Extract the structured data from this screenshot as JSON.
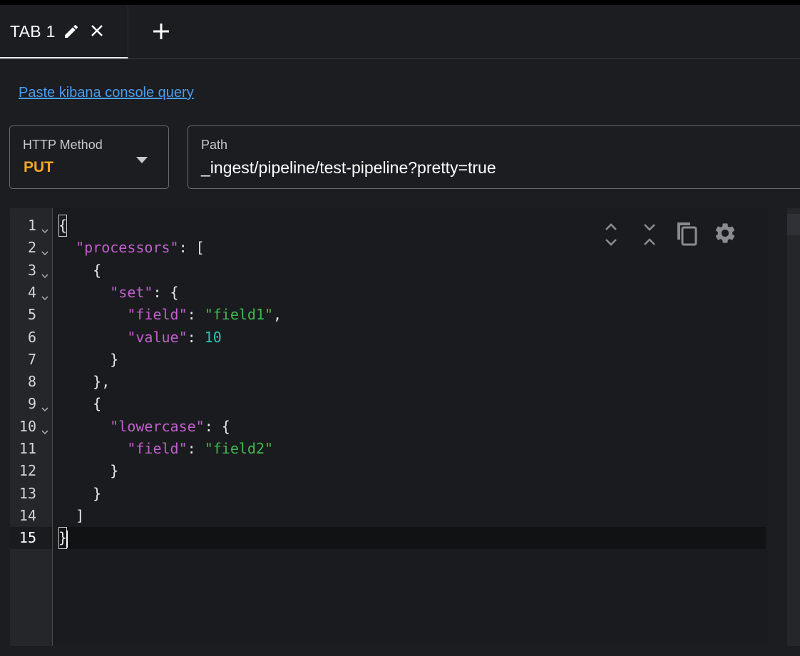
{
  "tabs": [
    {
      "label": "TAB 1",
      "active": true
    }
  ],
  "tab_actions": {
    "edit_icon": "pencil-icon",
    "close_icon": "close-icon",
    "add_icon": "plus-icon"
  },
  "paste_link": "Paste kibana console query",
  "method": {
    "label": "HTTP Method",
    "value": "PUT",
    "color": "#f5a623"
  },
  "path": {
    "label": "Path",
    "value": "_ingest/pipeline/test-pipeline?pretty=true"
  },
  "editor": {
    "line_numbers": [
      "1",
      "2",
      "3",
      "4",
      "5",
      "6",
      "7",
      "8",
      "9",
      "10",
      "11",
      "12",
      "13",
      "14",
      "15"
    ],
    "foldable_lines": [
      1,
      2,
      3,
      4,
      9,
      10
    ],
    "active_line": 15,
    "toolbar": [
      "expand-all-icon",
      "collapse-all-icon",
      "copy-icon",
      "gear-icon"
    ],
    "lines": [
      {
        "indent": "",
        "tokens": [
          {
            "t": "{",
            "c": "p"
          }
        ]
      },
      {
        "indent": "  ",
        "tokens": [
          {
            "t": "\"processors\"",
            "c": "k"
          },
          {
            "t": ": [",
            "c": "p"
          }
        ]
      },
      {
        "indent": "    ",
        "tokens": [
          {
            "t": "{",
            "c": "p"
          }
        ]
      },
      {
        "indent": "      ",
        "tokens": [
          {
            "t": "\"set\"",
            "c": "k"
          },
          {
            "t": ": {",
            "c": "p"
          }
        ]
      },
      {
        "indent": "        ",
        "tokens": [
          {
            "t": "\"field\"",
            "c": "k"
          },
          {
            "t": ": ",
            "c": "p"
          },
          {
            "t": "\"field1\"",
            "c": "s"
          },
          {
            "t": ",",
            "c": "p"
          }
        ]
      },
      {
        "indent": "        ",
        "tokens": [
          {
            "t": "\"value\"",
            "c": "k"
          },
          {
            "t": ": ",
            "c": "p"
          },
          {
            "t": "10",
            "c": "n"
          }
        ]
      },
      {
        "indent": "      ",
        "tokens": [
          {
            "t": "}",
            "c": "p"
          }
        ]
      },
      {
        "indent": "    ",
        "tokens": [
          {
            "t": "},",
            "c": "p"
          }
        ]
      },
      {
        "indent": "    ",
        "tokens": [
          {
            "t": "{",
            "c": "p"
          }
        ]
      },
      {
        "indent": "      ",
        "tokens": [
          {
            "t": "\"lowercase\"",
            "c": "k"
          },
          {
            "t": ": {",
            "c": "p"
          }
        ]
      },
      {
        "indent": "        ",
        "tokens": [
          {
            "t": "\"field\"",
            "c": "k"
          },
          {
            "t": ": ",
            "c": "p"
          },
          {
            "t": "\"field2\"",
            "c": "s"
          }
        ]
      },
      {
        "indent": "      ",
        "tokens": [
          {
            "t": "}",
            "c": "p"
          }
        ]
      },
      {
        "indent": "    ",
        "tokens": [
          {
            "t": "}",
            "c": "p"
          }
        ]
      },
      {
        "indent": "  ",
        "tokens": [
          {
            "t": "]",
            "c": "p"
          }
        ]
      },
      {
        "indent": "",
        "tokens": [
          {
            "t": "}",
            "c": "p"
          }
        ]
      }
    ]
  }
}
